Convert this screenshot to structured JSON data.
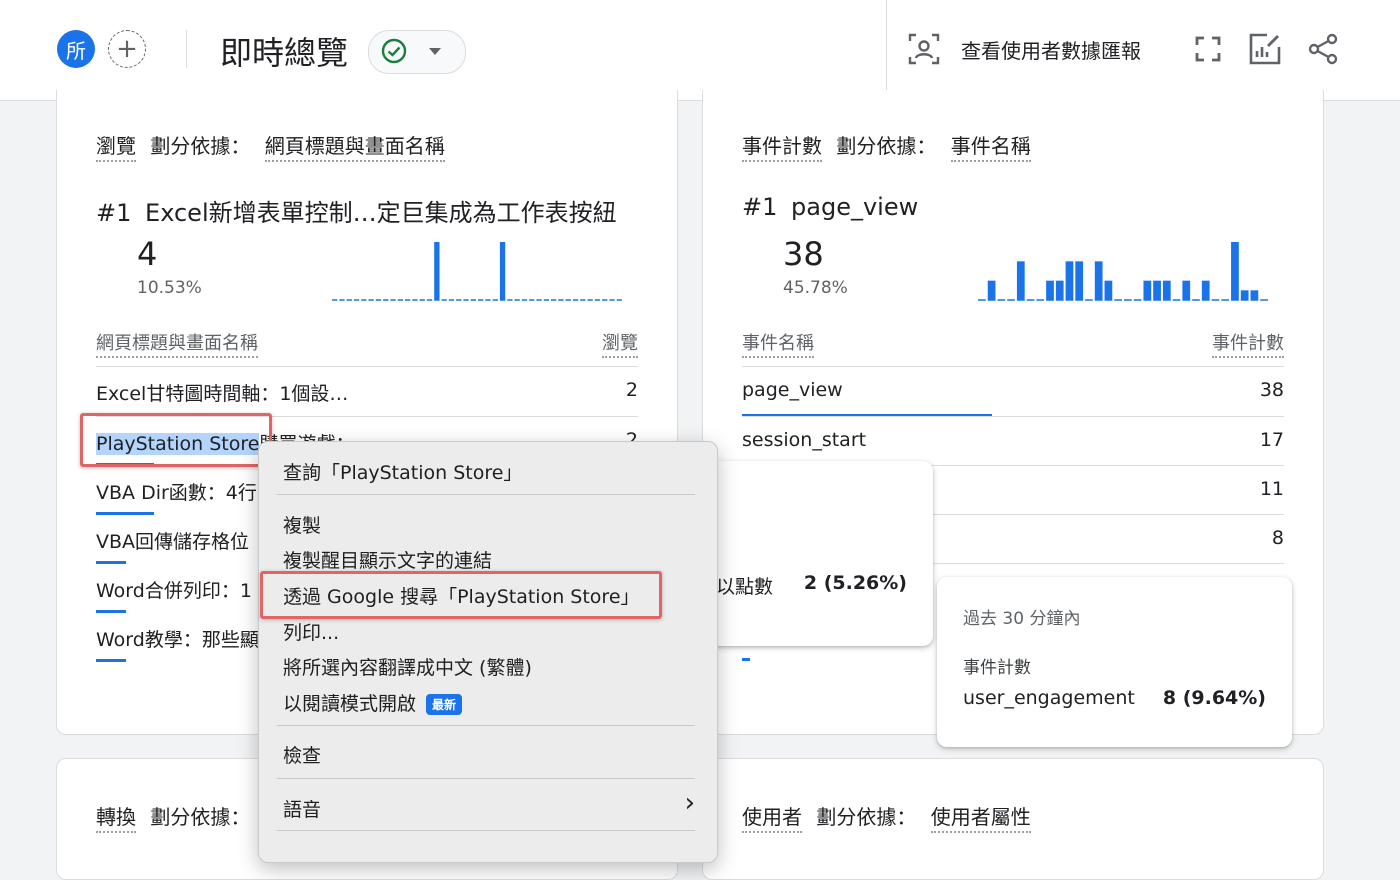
{
  "header": {
    "avatar_letter": "所",
    "add_symbol": "+",
    "title": "即時總覽",
    "user_report_label": "查看使用者數據匯報"
  },
  "card_views": {
    "metric": "瀏覽",
    "breakdown_label": "劃分依據：",
    "dimension": "網頁標題與畫面名稱",
    "top_rank": "#1",
    "top_name": "Excel新增表單控制…定巨集成為工作表按紐",
    "top_value": "4",
    "top_pct": "10.53%",
    "col_dim": "網頁標題與畫面名稱",
    "col_metric": "瀏覽",
    "rows": [
      {
        "name": "Excel甘特圖時間軸：1個設…",
        "value": "2"
      },
      {
        "name_sel": "PlayStation Store",
        "name_rest": "購買遊戲：",
        "value": "2"
      },
      {
        "name": "VBA Dir函數：4行"
      },
      {
        "name": "VBA回傳儲存格位"
      },
      {
        "name": "Word合併列印：1"
      },
      {
        "name": "Word教學：那些顯"
      }
    ],
    "sparkline": [
      0,
      0,
      0,
      0,
      0,
      0,
      0,
      0,
      0,
      0,
      0,
      0,
      0,
      0,
      4,
      0,
      0,
      0,
      0,
      0,
      0,
      0,
      0,
      4,
      0,
      0,
      0,
      0,
      0,
      0,
      0,
      0,
      0,
      0,
      0,
      0,
      0,
      0,
      0,
      0
    ]
  },
  "card_events": {
    "metric": "事件計數",
    "breakdown_label": "劃分依據：",
    "dimension": "事件名稱",
    "top_rank": "#1",
    "top_name": "page_view",
    "top_value": "38",
    "top_pct": "45.78%",
    "col_dim": "事件名稱",
    "col_metric": "事件計數",
    "rows": [
      {
        "name": "page_view",
        "value": "38"
      },
      {
        "name": "session_start",
        "value": "17"
      },
      {
        "name": "",
        "value": "11"
      },
      {
        "name": "",
        "value": "8"
      }
    ],
    "sparkline": [
      0,
      1,
      0,
      0,
      2,
      0,
      0,
      1,
      1,
      2,
      2,
      0,
      2,
      1,
      0,
      0,
      0,
      1,
      1,
      1,
      0,
      1,
      0,
      1,
      0,
      0,
      3,
      0.5,
      0.5,
      0
    ]
  },
  "tooltip_clicks": {
    "label": "以點數",
    "value": "2 (5.26%)"
  },
  "tooltip_events": {
    "title": "過去 30 分鐘內",
    "metric": "事件計數",
    "name": "user_engagement",
    "value": "8 (9.64%)"
  },
  "card_conversions": {
    "metric": "轉換",
    "breakdown_label": "劃分依據："
  },
  "card_users": {
    "metric": "使用者",
    "breakdown_label": "劃分依據：",
    "dimension": "使用者屬性"
  },
  "context_menu": {
    "lookup": "查詢「PlayStation Store」",
    "copy": "複製",
    "copy_link": "複製醒目顯示文字的連結",
    "search_google": "透過 Google 搜尋「PlayStation Store」",
    "print": "列印...",
    "translate": "將所選內容翻譯成中文 (繁體)",
    "reader_mode": "以閱讀模式開啟",
    "new_badge": "最新",
    "inspect": "檢查",
    "speech": "語音",
    "submenu_arrow": "›"
  },
  "colors": {
    "accent": "#1a73e8",
    "check_green": "#188038",
    "highlight_border": "#e06666",
    "selection": "#b3d4fc"
  }
}
